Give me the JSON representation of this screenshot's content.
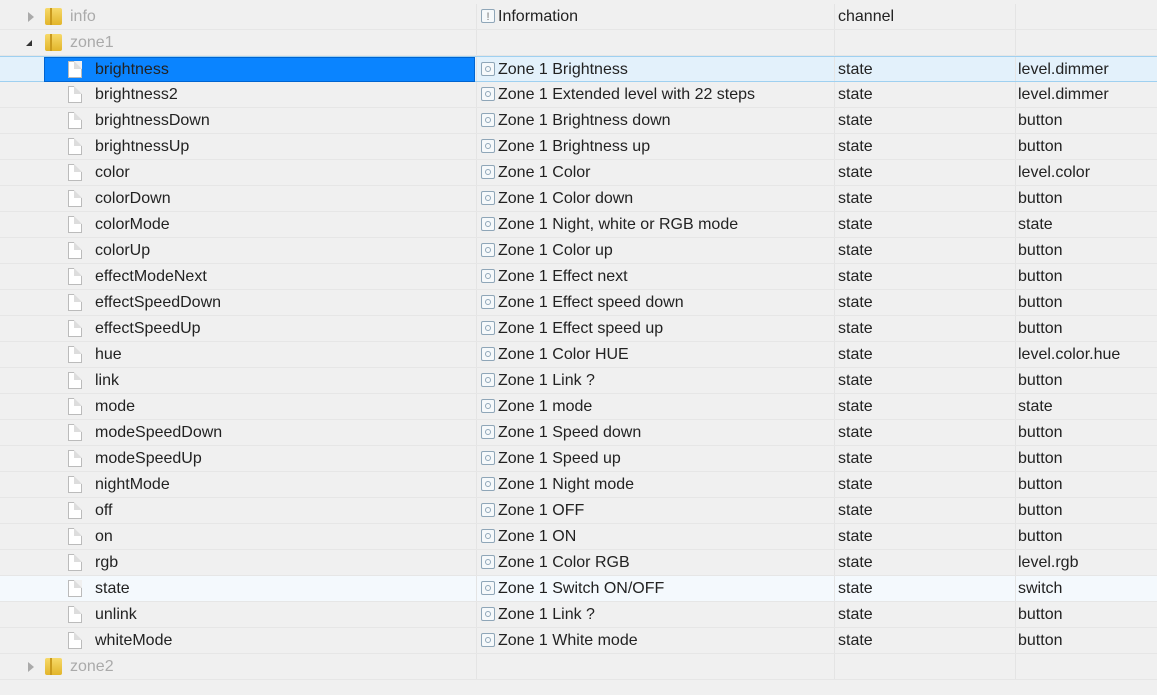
{
  "tree": [
    {
      "kind": "folder",
      "expanded": false,
      "name": "info",
      "title": "Information",
      "type": "channel",
      "role": "",
      "icon": "info"
    },
    {
      "kind": "folder",
      "expanded": true,
      "name": "zone1",
      "title": "",
      "type": "",
      "role": ""
    },
    {
      "kind": "state",
      "name": "brightness",
      "title": "Zone 1 Brightness",
      "type": "state",
      "role": "level.dimmer",
      "selected": true
    },
    {
      "kind": "state",
      "name": "brightness2",
      "title": "Zone 1 Extended level with 22 steps",
      "type": "state",
      "role": "level.dimmer"
    },
    {
      "kind": "state",
      "name": "brightnessDown",
      "title": "Zone 1 Brightness down",
      "type": "state",
      "role": "button"
    },
    {
      "kind": "state",
      "name": "brightnessUp",
      "title": "Zone 1 Brightness up",
      "type": "state",
      "role": "button"
    },
    {
      "kind": "state",
      "name": "color",
      "title": "Zone 1 Color",
      "type": "state",
      "role": "level.color"
    },
    {
      "kind": "state",
      "name": "colorDown",
      "title": "Zone 1 Color down",
      "type": "state",
      "role": "button"
    },
    {
      "kind": "state",
      "name": "colorMode",
      "title": "Zone 1 Night, white or RGB mode",
      "type": "state",
      "role": "state"
    },
    {
      "kind": "state",
      "name": "colorUp",
      "title": "Zone 1 Color up",
      "type": "state",
      "role": "button"
    },
    {
      "kind": "state",
      "name": "effectModeNext",
      "title": "Zone 1 Effect next",
      "type": "state",
      "role": "button"
    },
    {
      "kind": "state",
      "name": "effectSpeedDown",
      "title": "Zone 1 Effect speed down",
      "type": "state",
      "role": "button"
    },
    {
      "kind": "state",
      "name": "effectSpeedUp",
      "title": "Zone 1 Effect speed up",
      "type": "state",
      "role": "button"
    },
    {
      "kind": "state",
      "name": "hue",
      "title": "Zone 1 Color HUE",
      "type": "state",
      "role": "level.color.hue"
    },
    {
      "kind": "state",
      "name": "link",
      "title": "Zone 1 Link ?",
      "type": "state",
      "role": "button"
    },
    {
      "kind": "state",
      "name": "mode",
      "title": "Zone 1 mode",
      "type": "state",
      "role": "state"
    },
    {
      "kind": "state",
      "name": "modeSpeedDown",
      "title": "Zone 1 Speed down",
      "type": "state",
      "role": "button"
    },
    {
      "kind": "state",
      "name": "modeSpeedUp",
      "title": "Zone 1 Speed up",
      "type": "state",
      "role": "button"
    },
    {
      "kind": "state",
      "name": "nightMode",
      "title": "Zone 1 Night mode",
      "type": "state",
      "role": "button"
    },
    {
      "kind": "state",
      "name": "off",
      "title": "Zone 1 OFF",
      "type": "state",
      "role": "button"
    },
    {
      "kind": "state",
      "name": "on",
      "title": "Zone 1 ON",
      "type": "state",
      "role": "button"
    },
    {
      "kind": "state",
      "name": "rgb",
      "title": "Zone 1 Color RGB",
      "type": "state",
      "role": "level.rgb"
    },
    {
      "kind": "state",
      "name": "state",
      "title": "Zone 1 Switch ON/OFF",
      "type": "state",
      "role": "switch",
      "hover": true
    },
    {
      "kind": "state",
      "name": "unlink",
      "title": "Zone 1 Link ?",
      "type": "state",
      "role": "button"
    },
    {
      "kind": "state",
      "name": "whiteMode",
      "title": "Zone 1 White mode",
      "type": "state",
      "role": "button"
    },
    {
      "kind": "folder",
      "expanded": false,
      "name": "zone2",
      "title": "",
      "type": "",
      "role": ""
    }
  ],
  "colors": {
    "selection": "#0a84ff",
    "selected_row": "#e3f1fb"
  }
}
